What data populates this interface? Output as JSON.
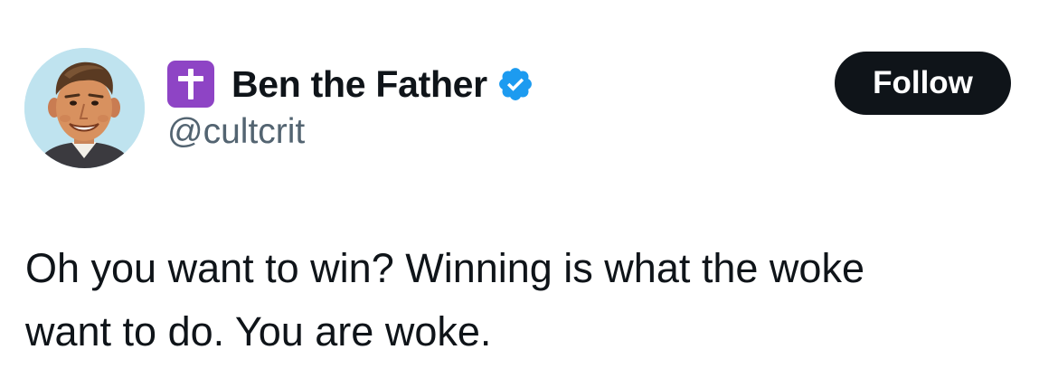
{
  "author": {
    "display_name": "Ben the Father",
    "handle": "@cultcrit",
    "badge_icon": "latin-cross-icon",
    "badge_color": "#8e44c5",
    "verified_icon": "verified-badge-icon",
    "verified_color": "#1d9bf0"
  },
  "follow_button": {
    "label": "Follow",
    "background": "#0f1419",
    "text_color": "#ffffff"
  },
  "tweet": {
    "lines": [
      "Oh you want to win? Winning is what the woke",
      "want to do. You are woke."
    ]
  },
  "colors": {
    "text_primary": "#0f1419",
    "text_secondary": "#536471"
  }
}
